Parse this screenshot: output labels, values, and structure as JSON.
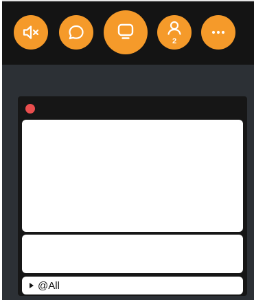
{
  "toolbar": {
    "buttons": [
      {
        "name": "mute",
        "icon": "speaker-muted-icon"
      },
      {
        "name": "chat",
        "icon": "chat-bubble-icon"
      },
      {
        "name": "present",
        "icon": "screen-share-icon"
      },
      {
        "name": "participants",
        "icon": "person-icon",
        "badge": "2"
      },
      {
        "name": "more",
        "icon": "ellipsis-icon"
      }
    ]
  },
  "panel": {
    "status_dot_color": "#ea4e4e",
    "recipient_label": "@All"
  },
  "colors": {
    "accent": "#f59a2a",
    "toolbar_bg": "#141414",
    "page_bg": "#2c3035",
    "panel_bg": "#161616"
  }
}
